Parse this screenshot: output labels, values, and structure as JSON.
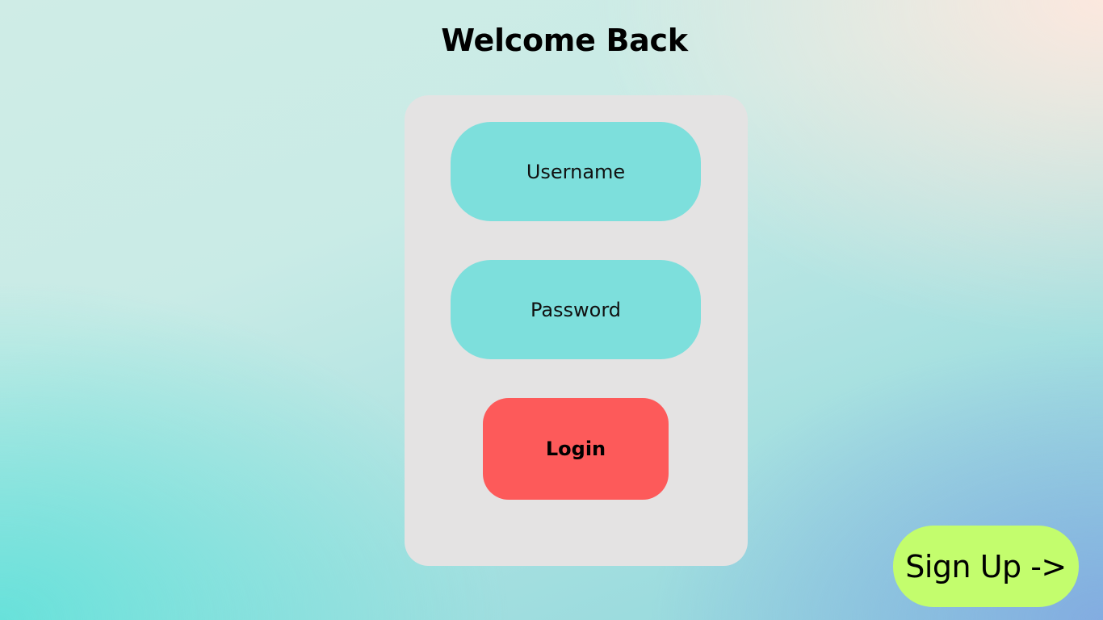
{
  "page": {
    "title": "Welcome Back"
  },
  "form": {
    "username_placeholder": "Username",
    "password_placeholder": "Password",
    "login_label": "Login"
  },
  "signup": {
    "label": "Sign Up ->"
  },
  "colors": {
    "card_background": "#e4e3e3",
    "field_background": "#7ddfdc",
    "login_button": "#fd5a5a",
    "signup_button": "#c3fd6d"
  }
}
